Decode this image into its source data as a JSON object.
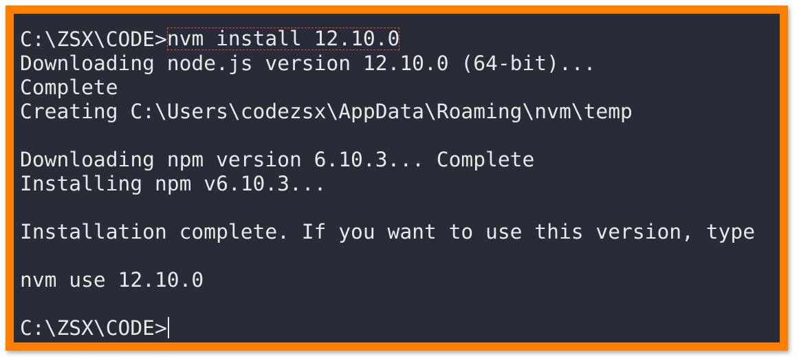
{
  "terminal": {
    "prompt": "C:\\ZSX\\CODE>",
    "command": "nvm install 12.10.0",
    "output": [
      "Downloading node.js version 12.10.0 (64-bit)...",
      "Complete",
      "Creating C:\\Users\\codezsx\\AppData\\Roaming\\nvm\\temp",
      "",
      "Downloading npm version 6.10.3... Complete",
      "Installing npm v6.10.3...",
      "",
      "Installation complete. If you want to use this version, type",
      "",
      "nvm use 12.10.0",
      ""
    ],
    "final_prompt": "C:\\ZSX\\CODE>"
  },
  "colors": {
    "frame": "#ff8000",
    "background": "#272c36",
    "text": "#e8e8e8",
    "highlight": "#e0463a"
  }
}
